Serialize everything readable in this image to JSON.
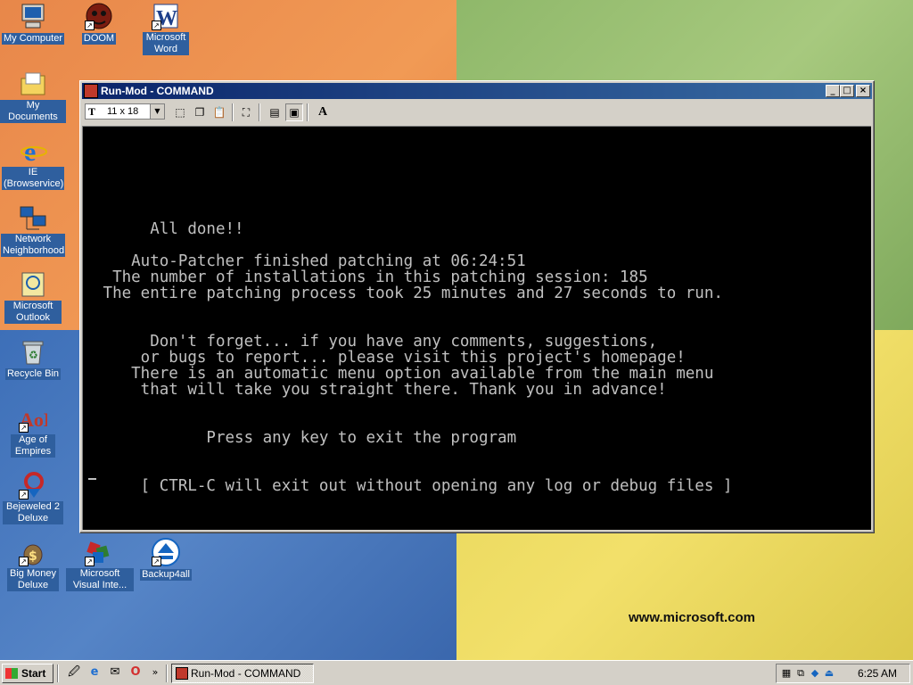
{
  "desktop": {
    "brand_text": "www.microsoft.com",
    "icons": [
      {
        "label": "My Computer",
        "icon": "computer-icon"
      },
      {
        "label": "DOOM",
        "icon": "doom-icon"
      },
      {
        "label": "Microsoft Word",
        "icon": "word-icon"
      },
      {
        "label": "My Documents",
        "icon": "folder-icon"
      },
      {
        "label": "IE (Browservice)",
        "icon": "ie-icon"
      },
      {
        "label": "Network Neighborhood",
        "icon": "network-icon"
      },
      {
        "label": "Microsoft Outlook",
        "icon": "outlook-icon"
      },
      {
        "label": "Recycle Bin",
        "icon": "recycle-bin-icon"
      },
      {
        "label": "Age of Empires",
        "icon": "age-of-empires-icon"
      },
      {
        "label": "Bejeweled 2 Deluxe",
        "icon": "bejeweled-icon"
      },
      {
        "label": "Big Money Deluxe",
        "icon": "big-money-icon"
      },
      {
        "label": "Microsoft Visual Inte...",
        "icon": "visual-interdev-icon"
      },
      {
        "label": "Backup4all",
        "icon": "backup-icon"
      }
    ]
  },
  "window": {
    "title": "Run-Mod - COMMAND",
    "toolbar": {
      "font_size": "11 x 18"
    }
  },
  "console": {
    "lines": [
      "",
      "",
      "",
      "      All done!!",
      "",
      "    Auto-Patcher finished patching at 06:24:51",
      "  The number of installations in this patching session: 185",
      " The entire patching process took 25 minutes and 27 seconds to run.",
      "",
      "",
      "      Don't forget... if you have any comments, suggestions,",
      "     or bugs to report... please visit this project's homepage!",
      "    There is an automatic menu option available from the main menu",
      "     that will take you straight there. Thank you in advance!",
      "",
      "",
      "            Press any key to exit the program",
      "",
      "",
      "     [ CTRL-C will exit out without opening any log or debug files ]"
    ]
  },
  "taskbar": {
    "start_label": "Start",
    "task_label": "Run-Mod - COMMAND",
    "clock": "6:25 AM"
  }
}
